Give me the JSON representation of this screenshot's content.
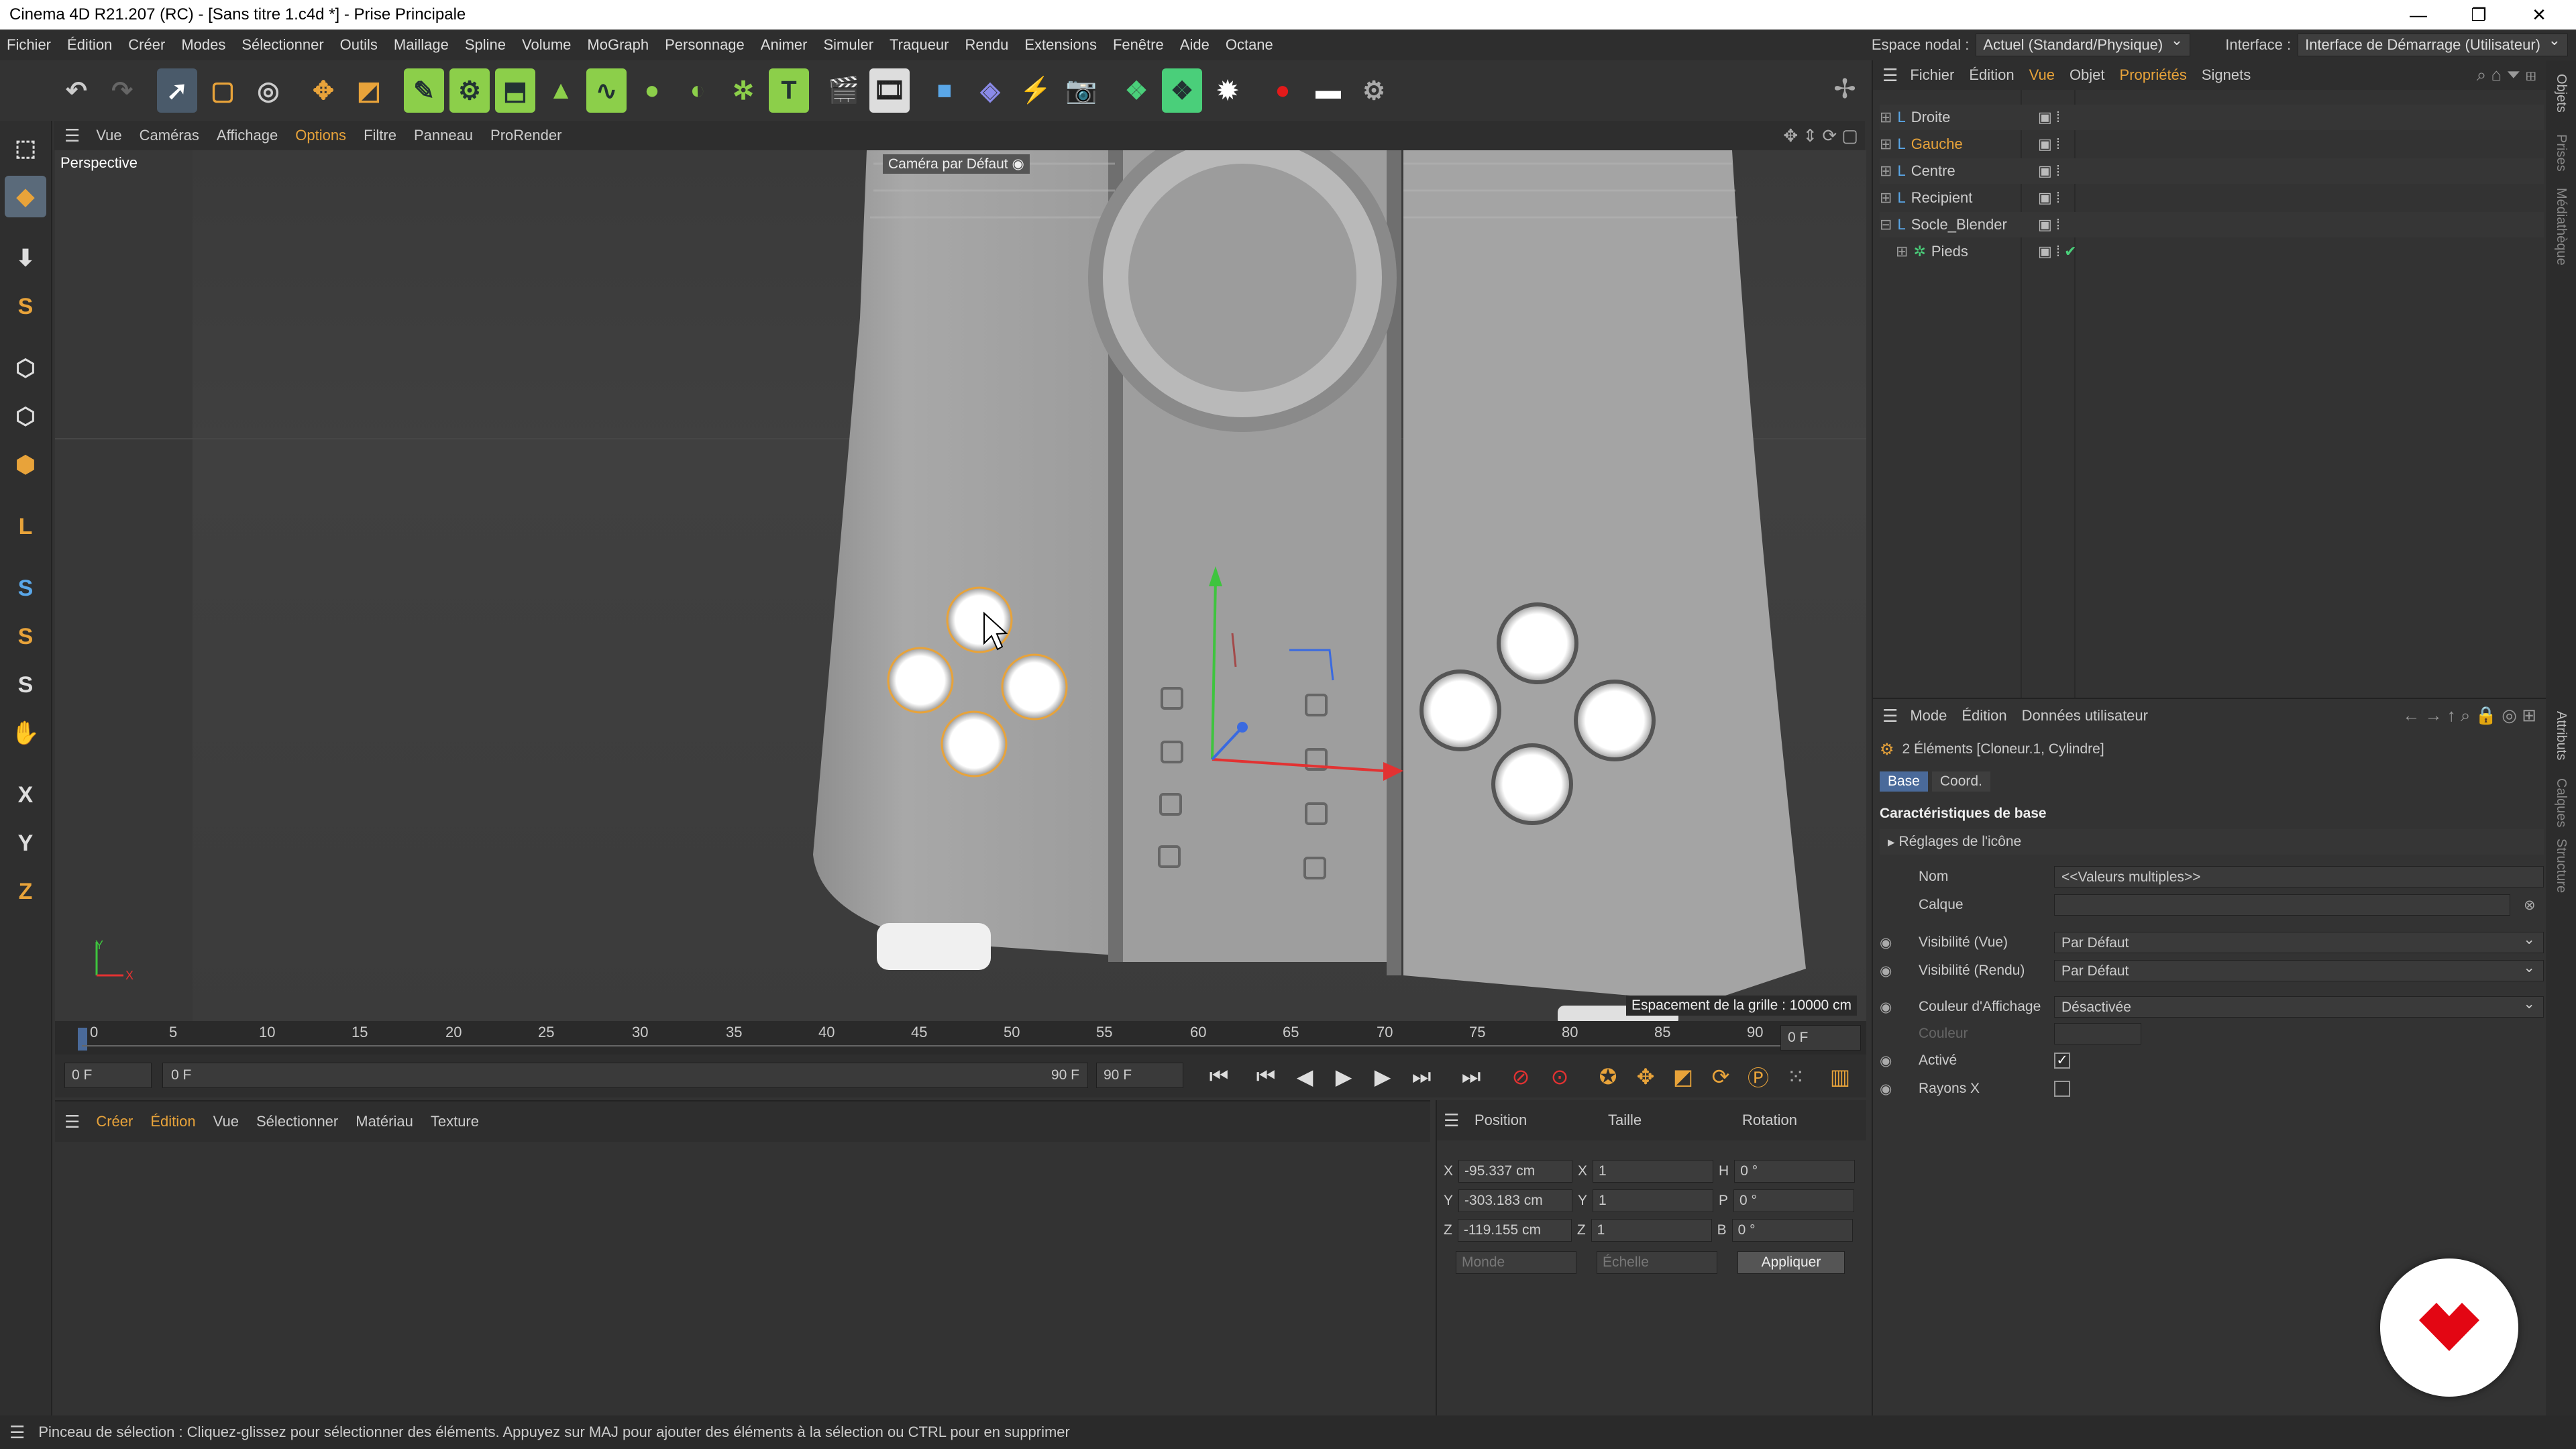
{
  "window": {
    "title": "Cinema 4D R21.207 (RC) - [Sans titre 1.c4d *] - Prise Principale",
    "minimize": "—",
    "restore": "❐",
    "close": "✕"
  },
  "menu": {
    "items": [
      "Fichier",
      "Édition",
      "Créer",
      "Modes",
      "Sélectionner",
      "Outils",
      "Maillage",
      "Spline",
      "Volume",
      "MoGraph",
      "Personnage",
      "Animer",
      "Simuler",
      "Traqueur",
      "Rendu",
      "Extensions",
      "Fenêtre",
      "Aide",
      "Octane"
    ],
    "espace_label": "Espace nodal :",
    "espace_value": "Actuel (Standard/Physique)",
    "interface_label": "Interface :",
    "interface_value": "Interface de Démarrage (Utilisateur)"
  },
  "viewport_menu": {
    "items": [
      "Vue",
      "Caméras",
      "Affichage",
      "Options",
      "Filtre",
      "Panneau",
      "ProRender"
    ]
  },
  "viewport": {
    "label": "Perspective",
    "camera": "Caméra par Défaut",
    "grid_spacing": "Espacement de la grille : 10000 cm",
    "axis_y": "Y",
    "axis_x": "X"
  },
  "timeline": {
    "ticks": [
      "0",
      "5",
      "10",
      "15",
      "20",
      "25",
      "30",
      "35",
      "40",
      "45",
      "50",
      "55",
      "60",
      "65",
      "70",
      "75",
      "80",
      "85",
      "90"
    ],
    "current": "0 F"
  },
  "playback": {
    "start": "0 F",
    "range_start": "0 F",
    "range_end": "90 F",
    "end": "90 F"
  },
  "material_menu": {
    "items": [
      "Créer",
      "Édition",
      "Vue",
      "Sélectionner",
      "Matériau",
      "Texture"
    ]
  },
  "coords": {
    "headers": [
      "Position",
      "Taille",
      "Rotation"
    ],
    "rows": [
      {
        "axis": "X",
        "pos": "-95.337 cm",
        "saxis": "X",
        "size": "1",
        "raxis": "H",
        "rot": "0 °"
      },
      {
        "axis": "Y",
        "pos": "-303.183 cm",
        "saxis": "Y",
        "size": "1",
        "raxis": "P",
        "rot": "0 °"
      },
      {
        "axis": "Z",
        "pos": "-119.155 cm",
        "saxis": "Z",
        "size": "1",
        "raxis": "B",
        "rot": "0 °"
      }
    ],
    "world": "Monde",
    "scale": "Échelle",
    "apply": "Appliquer"
  },
  "objmgr": {
    "menu": [
      "Fichier",
      "Édition",
      "Vue",
      "Objet",
      "Propriétés",
      "Signets"
    ],
    "objects": [
      {
        "name": "Droite",
        "highlight": false
      },
      {
        "name": "Gauche",
        "highlight": true
      },
      {
        "name": "Centre",
        "highlight": false
      },
      {
        "name": "Recipient",
        "highlight": false
      },
      {
        "name": "Socle_Blender",
        "highlight": false
      },
      {
        "name": "Pieds",
        "highlight": false
      }
    ]
  },
  "attr": {
    "menu": [
      "Mode",
      "Édition",
      "Données utilisateur"
    ],
    "selection": "2 Éléments [Cloneur.1, Cylindre]",
    "tabs": [
      "Base",
      "Coord."
    ],
    "section": "Caractéristiques de base",
    "subsection": "Réglages de l'icône",
    "fields": [
      {
        "label": "Nom",
        "value": "<<Valeurs multiples>>"
      },
      {
        "label": "Calque",
        "value": ""
      },
      {
        "label": "Visibilité (Vue)",
        "value": "Par Défaut"
      },
      {
        "label": "Visibilité (Rendu)",
        "value": "Par Défaut"
      },
      {
        "label": "Couleur d'Affichage",
        "value": "Désactivée"
      },
      {
        "label": "Couleur",
        "value": ""
      },
      {
        "label": "Activé",
        "value": ""
      },
      {
        "label": "Rayons X",
        "value": ""
      }
    ]
  },
  "right_tabs": [
    "Objets",
    "Prises",
    "Médiathèque",
    "Attributs",
    "Calques",
    "Structure"
  ],
  "status": "Pinceau de sélection : Cliquez-glissez pour sélectionner des éléments. Appuyez sur MAJ pour ajouter des éléments à la sélection ou CTRL pour en supprimer",
  "colors": {
    "accent": "#e8a33a",
    "highlight_obj": "#e8a33a",
    "logo_red": "#e30613"
  }
}
